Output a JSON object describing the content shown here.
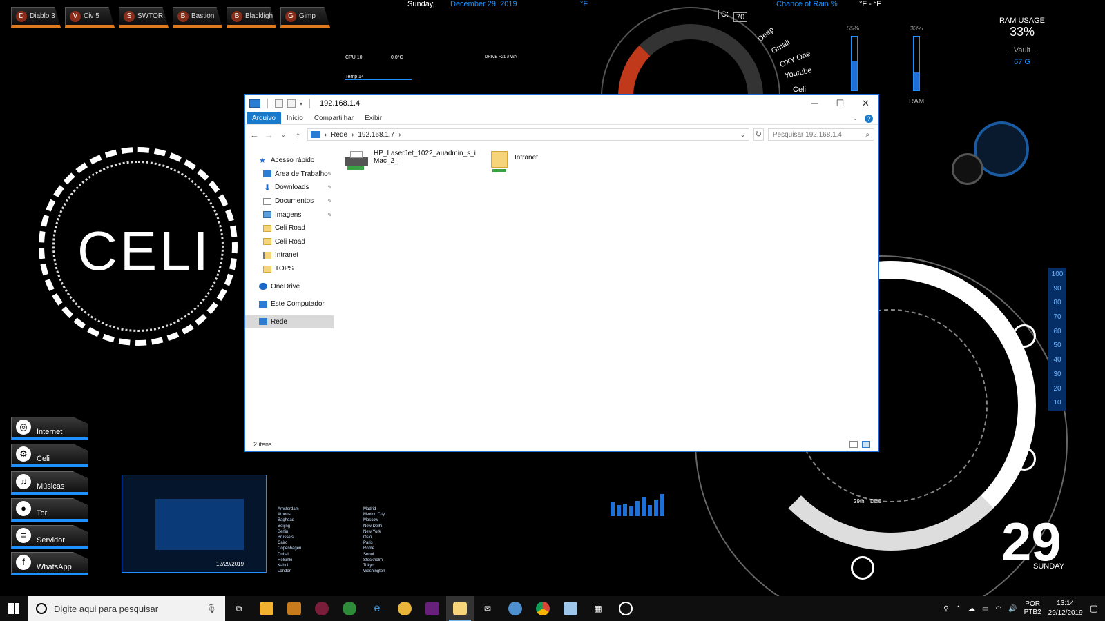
{
  "desktop": {
    "game_bar": [
      {
        "label": "Diablo 3",
        "icon": "diablo-icon"
      },
      {
        "label": "Civ 5",
        "icon": "civ-icon"
      },
      {
        "label": "SWTOR",
        "icon": "swtor-icon"
      },
      {
        "label": "Bastion",
        "icon": "bastion-icon"
      },
      {
        "label": "Blacklight",
        "icon": "blacklight-icon"
      },
      {
        "label": "Gimp",
        "icon": "gimp-icon"
      }
    ],
    "top_day": "Sunday,",
    "top_date": "December 29, 2019",
    "top_temp_unit": "°F",
    "top_rain": "Chance of Rain %",
    "top_temp_range": "°F - °F",
    "cpu_label": "CPU 10",
    "cpu_value": "0.0°C",
    "temp_label": "Temp 14",
    "drive_label": "DRIVE F21 // WA",
    "hud_links": [
      "Deep",
      "Gmail",
      "OXY One",
      "Youtube",
      "Celi"
    ],
    "hud_drive_letter": "C:",
    "hud_drive_value": "70",
    "logo_text": "CELI",
    "bar1_pct_label": "55%",
    "bar1_fraction": 0.55,
    "bar2_pct_label": "33%",
    "bar2_fraction": 0.33,
    "bar2_caption": "RAM",
    "ram_usage_title": "RAM USAGE",
    "ram_usage_value": "33%",
    "vault_label": "Vault",
    "vault_value": "67 G",
    "scale_ticks": [
      "100",
      "90",
      "80",
      "70",
      "60",
      "50",
      "40",
      "30",
      "20",
      "10"
    ],
    "side_launchers": [
      {
        "label": "Internet",
        "icon": "chrome-icon",
        "glyph": "◎"
      },
      {
        "label": "Celi",
        "icon": "steam-icon",
        "glyph": "⚙"
      },
      {
        "label": "Músicas",
        "icon": "music-icon",
        "glyph": "♫"
      },
      {
        "label": "Tor",
        "icon": "tor-icon",
        "glyph": "●"
      },
      {
        "label": "Servidor",
        "icon": "server-icon",
        "glyph": "≡"
      },
      {
        "label": "WhatsApp",
        "icon": "facebook-icon",
        "glyph": "f"
      }
    ],
    "world_date": "12/29/2019",
    "world_clocks_left": [
      "Amsterdam",
      "Athens",
      "Baghdad",
      "Beijing",
      "Berlin",
      "Brussels",
      "Cairo",
      "Copenhagen",
      "Dubai",
      "Helsinki",
      "Kabul",
      "London"
    ],
    "world_clocks_right": [
      "Madrid",
      "Mexico City",
      "Moscow",
      "New Delhi",
      "New York",
      "Oslo",
      "Paris",
      "Rome",
      "Seoul",
      "Stockholm",
      "Tokyo",
      "Washington"
    ],
    "big_day_number": "29",
    "big_day_name": "SUNDAY",
    "dial_day": "29th",
    "dial_month": "DEC"
  },
  "explorer": {
    "title": "192.168.1.4",
    "controls": {
      "minimize": "─",
      "maximize": "☐",
      "close": "✕"
    },
    "ribbon_tabs": [
      "Arquivo",
      "Início",
      "Compartilhar",
      "Exibir"
    ],
    "help_glyph": "?",
    "address_crumbs": [
      "Rede",
      "192.168.1.7"
    ],
    "search_placeholder": "Pesquisar 192.168.1.4",
    "nav": {
      "quick_access": "Acesso rápido",
      "pinned": [
        {
          "label": "Área de Trabalho",
          "icon": "desktop-icon"
        },
        {
          "label": "Downloads",
          "icon": "download-icon"
        },
        {
          "label": "Documentos",
          "icon": "documents-icon"
        },
        {
          "label": "Imagens",
          "icon": "images-icon"
        }
      ],
      "folders": [
        "Celi Road",
        "Celi Road",
        "Intranet",
        "TOPS"
      ],
      "onedrive": "OneDrive",
      "this_pc": "Este Computador",
      "network": "Rede"
    },
    "items": [
      {
        "name": "HP_LaserJet_1022_auadmin_s_iMac_2_",
        "type": "printer"
      },
      {
        "name": "Intranet",
        "type": "shared-folder"
      }
    ],
    "status": "2 itens"
  },
  "taskbar": {
    "search_placeholder": "Digite aqui para pesquisar",
    "apps": [
      "task-view-icon",
      "file-manager-icon",
      "app-icon",
      "app-icon-2",
      "app-icon-3",
      "edge-icon",
      "browser-icon",
      "visual-studio-icon",
      "file-explorer-icon",
      "mail-icon",
      "app-icon-4",
      "chrome-icon",
      "app-icon-5",
      "calculator-icon",
      "app-icon-6"
    ],
    "lang_top": "POR",
    "lang_bottom": "PTB2",
    "time": "13:14",
    "date": "29/12/2019"
  },
  "colors": {
    "accent": "#1979ca",
    "hud_blue": "#1e90ff",
    "game_orange": "#e07a1f"
  }
}
